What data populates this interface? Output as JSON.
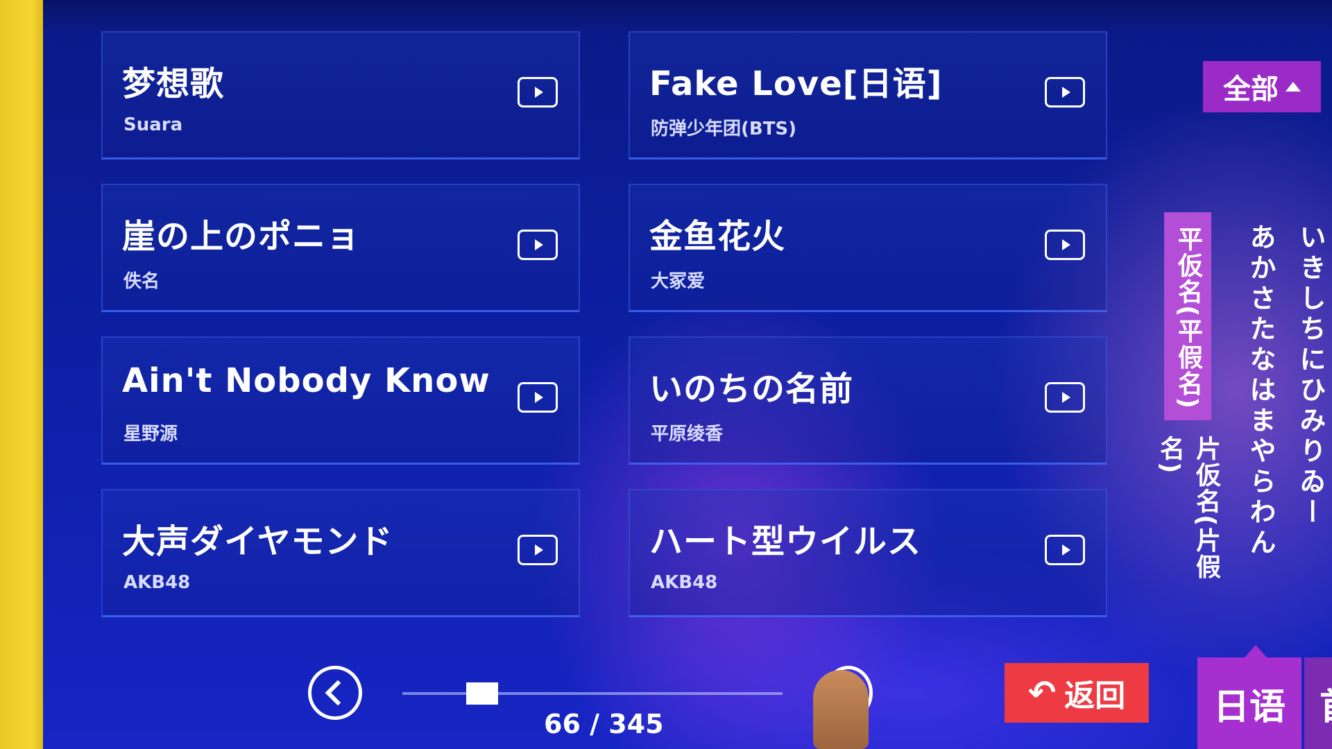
{
  "songs": [
    {
      "title": "梦想歌",
      "artist": "Suara"
    },
    {
      "title": "Fake Love[日语]",
      "artist": "防弹少年团(BTS)"
    },
    {
      "title": "崖の上のポニョ",
      "artist": "佚名"
    },
    {
      "title": "金鱼花火",
      "artist": "大冢爱"
    },
    {
      "title": "Ain't Nobody Know",
      "artist": "星野源"
    },
    {
      "title": "いのちの名前",
      "artist": "平原绫香"
    },
    {
      "title": "大声ダイヤモンド",
      "artist": "AKB48"
    },
    {
      "title": "ハート型ウイルス",
      "artist": "AKB48"
    }
  ],
  "filter": {
    "all_label": "全部"
  },
  "kana_index": {
    "hiragana_label": "平仮名(平假名)",
    "katakana_label": "片仮名(片假名)",
    "column1": "あかさたなはまやらわん",
    "column2": "いきしちにひみりゐー"
  },
  "pager": {
    "current": "66",
    "total": "345",
    "display": "66 / 345",
    "progress": 0.19
  },
  "buttons": {
    "back_label": "返回"
  },
  "language_tabs": {
    "active": "日语",
    "next": "首拼"
  },
  "icons": {
    "play": "play-icon",
    "back": "return-arrow-icon",
    "prev": "chevron-left-icon"
  }
}
